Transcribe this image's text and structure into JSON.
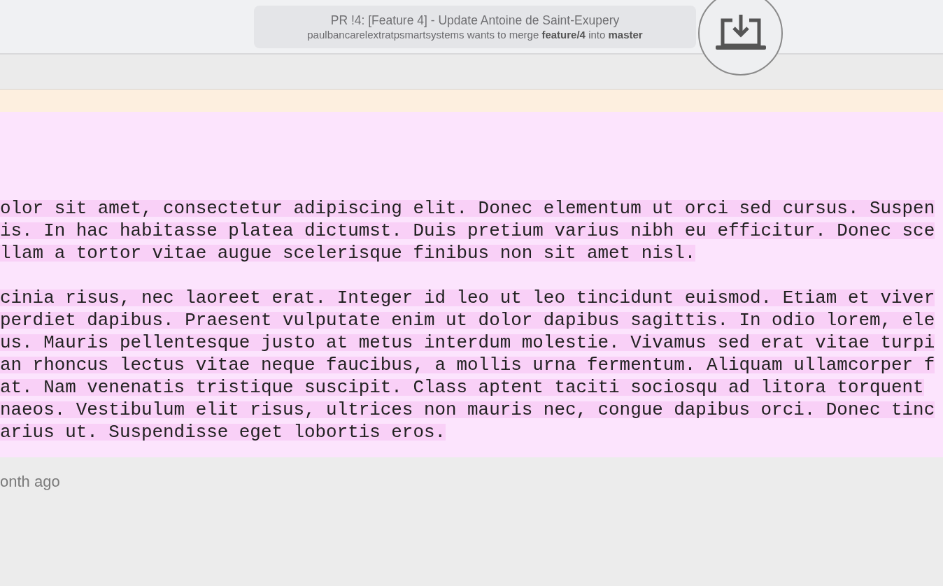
{
  "pr_banner": {
    "title": "PR !4: [Feature 4] - Update Antoine de Saint-Exupery",
    "subtitle": "paulbancarelextratpsmartsystems wants to merge **feature/4** into **master**"
  },
  "code_block": {
    "paragraphs": [
      [
        "olor sit amet, consectetur adipiscing elit. Donec elementum ut orci sed cursus. Suspen",
        "is. In hac habitasse platea dictumst. Duis pretium varius nibh eu efficitur. Donec sce",
        "llam a tortor vitae augue scelerisque finibus non sit amet nisl."
      ],
      [
        "cinia risus, nec laoreet erat. Integer id leo ut leo tincidunt euismod. Etiam et viver",
        "perdiet dapibus. Praesent vulputate enim ut dolor dapibus sagittis. In odio lorem, ele",
        "us. Mauris pellentesque justo at metus interdum molestie. Vivamus sed erat vitae turpi",
        "an rhoncus lectus vitae neque faucibus, a mollis urna fermentum. Aliquam ullamcorper f",
        "at. Nam venenatis tristique suscipit. Class aptent taciti sociosqu ad litora torquent",
        "naeos. Vestibulum elit risus, ultrices non mauris nec, congue dapibus orci. Donec tinc",
        "arius ut. Suspendisse eget lobortis eros."
      ]
    ]
  },
  "timestamp": "onth ago"
}
